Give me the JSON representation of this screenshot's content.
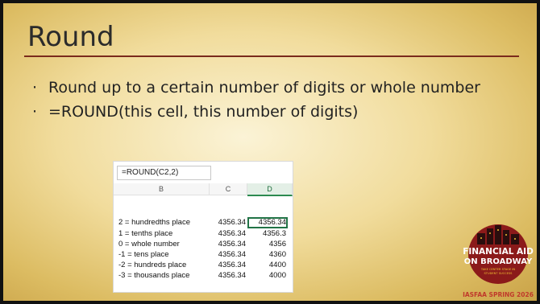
{
  "slide": {
    "title": "Round",
    "bullets": [
      "Round up to a certain number of digits or whole number",
      "=ROUND(this cell, this number of digits)"
    ]
  },
  "spreadsheet": {
    "formula": "=ROUND(C2,2)",
    "columns": [
      "B",
      "C",
      "D"
    ],
    "rows": [
      {
        "b": "2 = hundredths place",
        "c": "4356.34",
        "d": "4356.34"
      },
      {
        "b": "1 = tenths place",
        "c": "4356.34",
        "d": "4356.3"
      },
      {
        "b": "0 = whole number",
        "c": "4356.34",
        "d": "4356"
      },
      {
        "b": "-1 = tens place",
        "c": "4356.34",
        "d": "4360"
      },
      {
        "b": "-2 = hundreds place",
        "c": "4356.34",
        "d": "4400"
      },
      {
        "b": "-3 = thousands place",
        "c": "4356.34",
        "d": "4000"
      }
    ]
  },
  "logo": {
    "line1": "FINANCIAL AID",
    "line2": "ON BROADWAY",
    "tagline1": "TAKE CENTER STAGE IN",
    "tagline2": "STUDENT SUCCESS",
    "footer": "IASFAA SPRING 2026",
    "colors": {
      "badge": "#8b1a1a",
      "gold": "#f1c232",
      "footer": "#c0392b"
    }
  }
}
